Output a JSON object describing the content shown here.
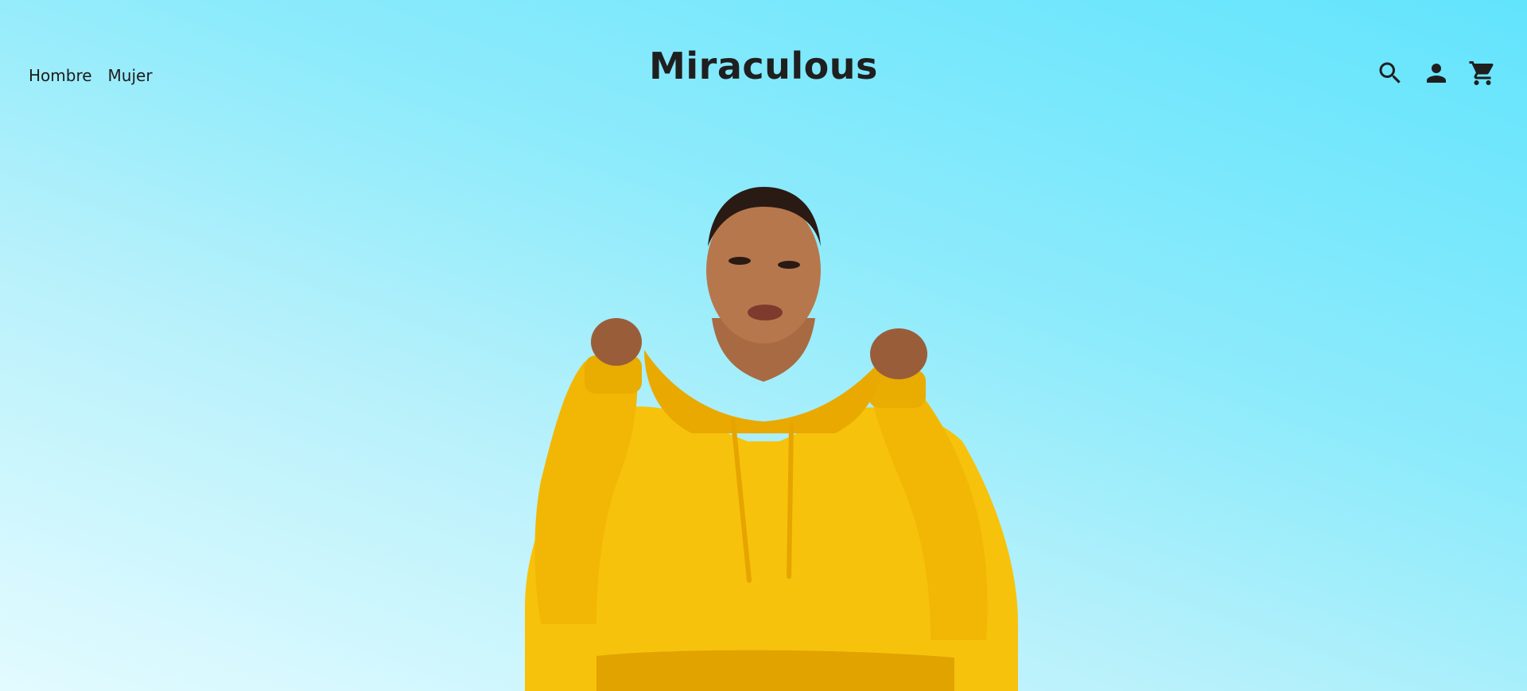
{
  "brand": {
    "name": "Miraculous"
  },
  "nav": {
    "items": [
      {
        "label": "Hombre"
      },
      {
        "label": "Mujer"
      }
    ]
  },
  "header_icons": [
    {
      "icon": "search-icon"
    },
    {
      "icon": "account-icon"
    },
    {
      "icon": "cart-icon"
    }
  ],
  "hero": {
    "image": "hero-model-yellow-hoodie",
    "colors": {
      "sky_top": "#62e4fd",
      "sky_bottom": "#e2fbff",
      "hoodie": "#f7c20c"
    }
  }
}
